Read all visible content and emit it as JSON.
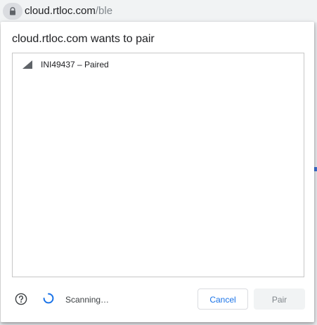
{
  "address_bar": {
    "host": "cloud.rtloc.com",
    "path": "/ble",
    "lock_icon": "lock-icon"
  },
  "dialog": {
    "title": "cloud.rtloc.com wants to pair",
    "devices": [
      {
        "label": "INI49437 – Paired",
        "icon": "signal-strength-icon"
      }
    ],
    "help_icon": "help-circle-icon",
    "status_text": "Scanning…",
    "cancel_label": "Cancel",
    "pair_label": "Pair"
  },
  "colors": {
    "accent": "#1a73e8",
    "spinner": "#1a73e8",
    "disabled_text": "#80868b",
    "disabled_bg": "#f1f3f4",
    "title_text": "#202124"
  }
}
